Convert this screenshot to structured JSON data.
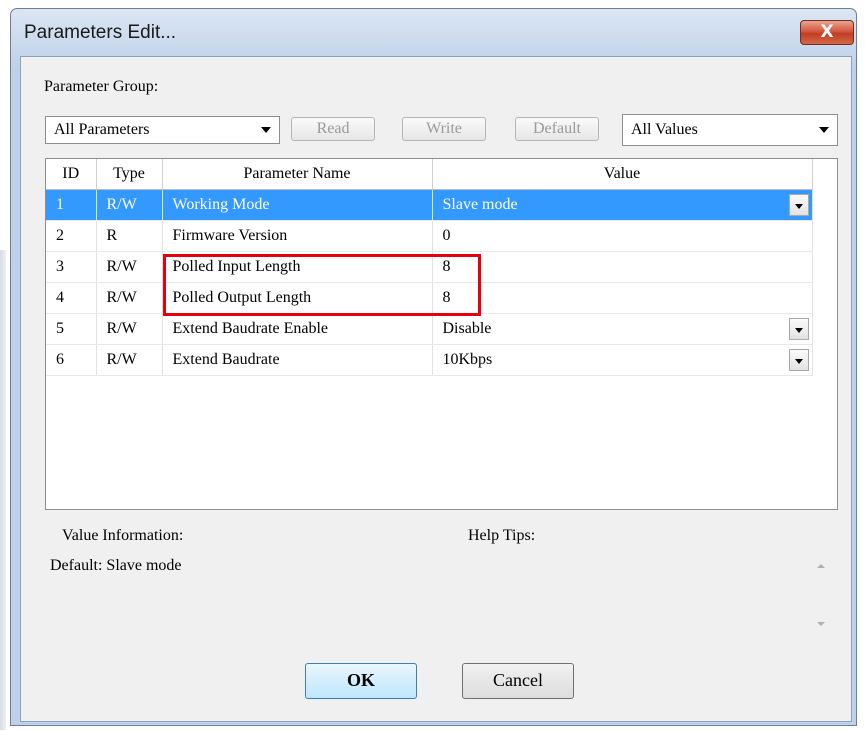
{
  "window": {
    "title": "Parameters Edit...",
    "close_glyph": "X"
  },
  "group": {
    "label": "Parameter Group:",
    "selected": "All Parameters",
    "read_label": "Read",
    "write_label": "Write",
    "default_label": "Default",
    "values_filter": "All Values"
  },
  "table": {
    "headers": {
      "id": "ID",
      "type": "Type",
      "name": "Parameter Name",
      "value": "Value"
    },
    "rows": [
      {
        "id": "1",
        "type": "R/W",
        "name": "Working Mode",
        "value": "Slave mode"
      },
      {
        "id": "2",
        "type": "R",
        "name": "Firmware Version",
        "value": "0"
      },
      {
        "id": "3",
        "type": "R/W",
        "name": "Polled Input Length",
        "value": "8"
      },
      {
        "id": "4",
        "type": "R/W",
        "name": "Polled Output Length",
        "value": "8"
      },
      {
        "id": "5",
        "type": "R/W",
        "name": "Extend Baudrate Enable",
        "value": "Disable"
      },
      {
        "id": "6",
        "type": "R/W",
        "name": "Extend Baudrate",
        "value": "10Kbps"
      }
    ]
  },
  "info": {
    "value_info_label": "Value Information:",
    "default_text": "Default:  Slave mode",
    "help_tips_label": "Help Tips:"
  },
  "buttons": {
    "ok": "OK",
    "cancel": "Cancel"
  },
  "colors": {
    "selection": "#3399ff",
    "highlight_box": "#e8000f",
    "close_button": "#c23d22"
  }
}
